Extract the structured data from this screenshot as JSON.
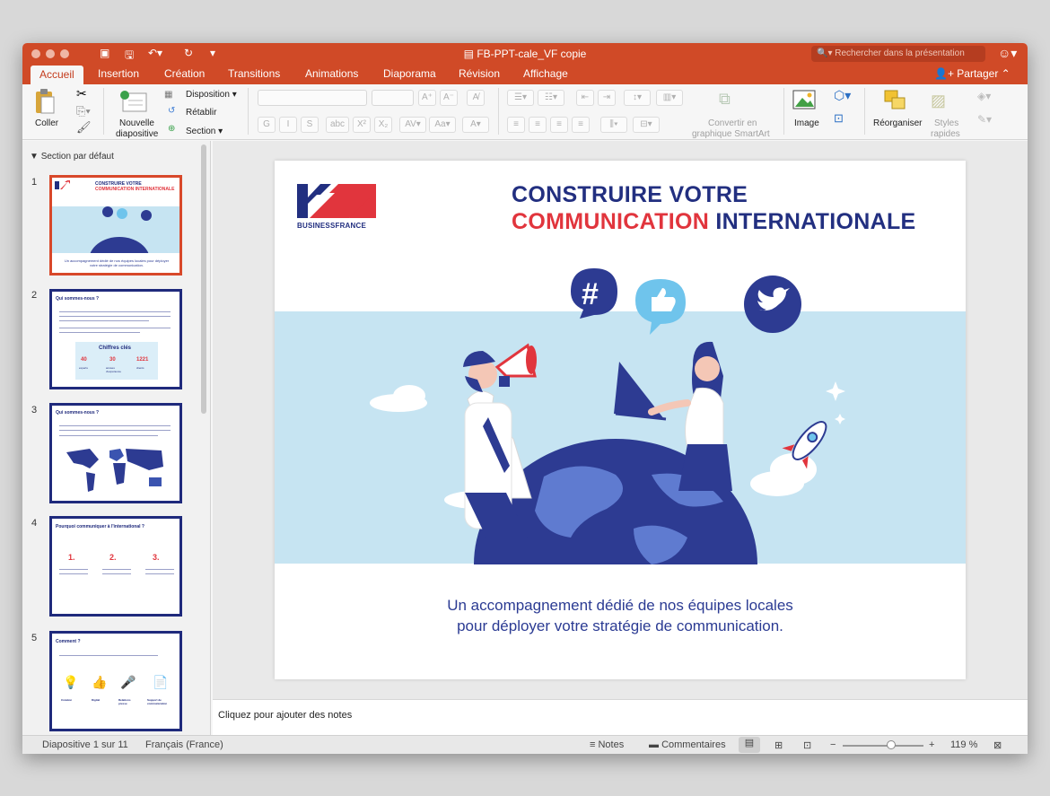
{
  "window": {
    "title": "FB-PPT-cale_VF copie",
    "search_placeholder": "Rechercher dans la présentation"
  },
  "tabs": [
    "Accueil",
    "Insertion",
    "Création",
    "Transitions",
    "Animations",
    "Diaporama",
    "Révision",
    "Affichage"
  ],
  "share_label": "Partager",
  "ribbon": {
    "paste_label": "Coller",
    "new_slide_label_1": "Nouvelle",
    "new_slide_label_2": "diapositive",
    "layout_label": "Disposition",
    "reset_label": "Rétablir",
    "section_label": "Section",
    "bold": "G",
    "italic": "I",
    "underline": "S",
    "strikethrough": "abc",
    "superscript": "X²",
    "subscript": "X₂",
    "smartart_label_1": "Convertir en",
    "smartart_label_2": "graphique SmartArt",
    "image_label": "Image",
    "arrange_label": "Réorganiser",
    "styles_label_1": "Styles",
    "styles_label_2": "rapides"
  },
  "sidebar": {
    "section_title": "Section par défaut",
    "thumbs": [
      {
        "num": "1",
        "title_a": "CONSTRUIRE VOTRE",
        "title_b": "COMMUNICATION INTERNATIONALE",
        "caption": "Un accompagnement dédié de nos équipes locales pour déployer votre stratégie de communication."
      },
      {
        "num": "2",
        "title": "Qui sommes-nous ?",
        "box_title": "Chiffres clés",
        "stats": [
          "40",
          "30",
          "1221"
        ],
        "stat_labels": [
          "experts",
          "années d'expérience",
          "clients"
        ]
      },
      {
        "num": "3",
        "title": "Qui sommes-nous ?"
      },
      {
        "num": "4",
        "title": "Pourquoi communiquer à l'international ?",
        "steps": [
          "1.",
          "2.",
          "3."
        ]
      },
      {
        "num": "5",
        "title": "Comment ?",
        "icons": [
          "Création",
          "Digital",
          "Relations presse",
          "Support de communication"
        ]
      }
    ]
  },
  "slide": {
    "logo_text": "BUSINESSFRANCE",
    "title_line1": "CONSTRUIRE VOTRE",
    "title_line2_accent": "COMMUNICATION",
    "title_line2_rest": " INTERNATIONALE",
    "subtitle_line1": "Un accompagnement dédié de nos équipes locales",
    "subtitle_line2": "pour déployer votre stratégie de communication.",
    "hashtag": "#"
  },
  "notes_placeholder": "Cliquez pour ajouter des notes",
  "statusbar": {
    "slide_info": "Diapositive 1 sur 11",
    "language": "Français (France)",
    "notes_label": "Notes",
    "comments_label": "Commentaires",
    "zoom": "119 %",
    "zoom_level": 0.6
  },
  "colors": {
    "accent": "#d04a27",
    "navy": "#222f80",
    "red": "#e1353d",
    "sky": "#c6e4f2"
  }
}
